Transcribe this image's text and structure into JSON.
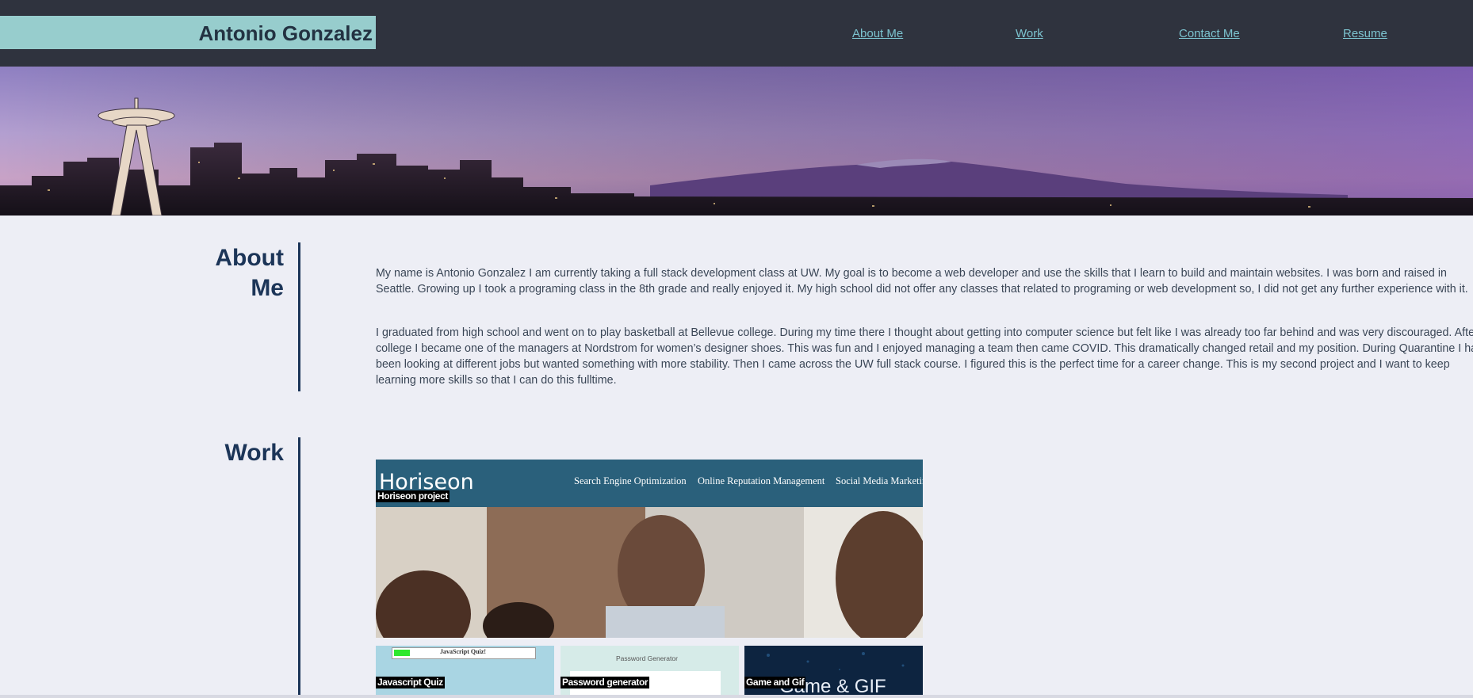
{
  "header": {
    "name": "Antonio Gonzalez",
    "nav": [
      "About Me",
      "Work",
      "Contact Me",
      "Resume"
    ]
  },
  "about": {
    "title_line1": "About",
    "title_line2": "Me",
    "paragraphs": [
      "My name is Antonio Gonzalez I am currently taking a full stack development class at UW. My goal is to become a web developer and use the skills that I learn to build and maintain websites. I was born and raised in Seattle. Growing up I took a programing class in the 8th grade and really enjoyed it. My high school did not offer any classes that related to programing or web development so, I did not get any further experience with it.",
      "I graduated from high school and went on to play basketball at Bellevue college. During my time there I thought about getting into computer science but felt like I was already too far behind and was very discouraged. After college I became one of the managers at Nordstrom for women’s designer shoes. This was fun and I enjoyed managing a team then came COVID. This dramatically changed retail and my position. During Quarantine I had been looking at different jobs but wanted something with more stability. Then I came across the UW full stack course. I figured this is the perfect time for a career change. This is my second project and I want to keep learning more skills so that I can do this fulltime."
    ]
  },
  "work": {
    "title": "Work",
    "featured": {
      "label": "Horiseon project",
      "brand": "Horiseon",
      "nav": [
        "Search Engine Optimization",
        "Online Reputation Management",
        "Social Media Marketing"
      ]
    },
    "projects": [
      {
        "label": "Javascript Quiz",
        "header": "JavaScript Quiz!"
      },
      {
        "label": "Password generator",
        "header": "Password Generator"
      },
      {
        "label": "Game and Gif",
        "header": "Game & GIF"
      }
    ]
  },
  "colors": {
    "header_bg": "#2f333e",
    "brand_bg": "#97cdcd",
    "nav_link": "#7cc3cf",
    "heading": "#1c3558",
    "page_bg": "#edeef5"
  }
}
